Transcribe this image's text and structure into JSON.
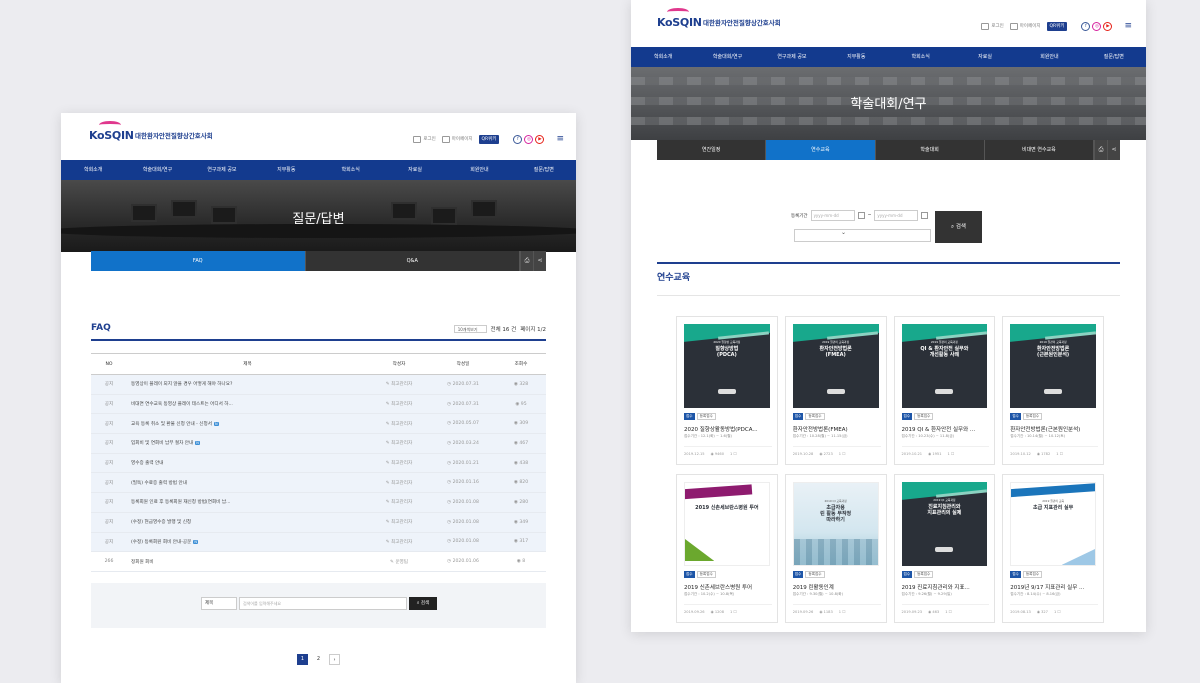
{
  "header": {
    "logo_text": "KoSQIN",
    "org_name": "대한환자안전질향상간호사회",
    "login_label": "로그인",
    "mypage_label": "마이페이지",
    "qr_label": "QR위키",
    "sns": [
      "f",
      "◎",
      "▶"
    ]
  },
  "gnb": [
    "학회소개",
    "학술대회/연구",
    "연구과제 공모",
    "지부활동",
    "학회소식",
    "자료실",
    "회원안내",
    "질문/답변"
  ],
  "left": {
    "hero_title": "질문/답변",
    "subnav": [
      "FAQ",
      "Q&A"
    ],
    "board": {
      "title": "FAQ",
      "per_page": "10개씩보기",
      "total": "전체 16 건",
      "page_info": "페이지 1/2",
      "columns": [
        "NO",
        "제목",
        "작성자",
        "작성일",
        "조회수"
      ],
      "rows": [
        {
          "no": "공지",
          "title": "동영상이 플레이 되지 않을 경우 어떻게 해야 하나요?",
          "writer": "최고관리자",
          "date": "2020.07.31",
          "views": "328",
          "new": false
        },
        {
          "no": "공지",
          "title": "비대면 연수교육 동영상 플레이 테스트는 어디서 하...",
          "writer": "최고관리자",
          "date": "2020.07.31",
          "views": "95",
          "new": false
        },
        {
          "no": "공지",
          "title": "교육 등록 취소 및 환불 신청 안내 - 신청서",
          "writer": "최고관리자",
          "date": "2020.05.07",
          "views": "309",
          "new": true
        },
        {
          "no": "공지",
          "title": "입회비 및 연회비 납부 절차 안내",
          "writer": "최고관리자",
          "date": "2020.03.24",
          "views": "467",
          "new": true
        },
        {
          "no": "공지",
          "title": "영수증 출력 안내",
          "writer": "최고관리자",
          "date": "2020.01.21",
          "views": "438",
          "new": false
        },
        {
          "no": "공지",
          "title": "(필독) 수료증 출력 방법 안내",
          "writer": "최고관리자",
          "date": "2020.01.16",
          "views": "820",
          "new": false
        },
        {
          "no": "공지",
          "title": "등록회원 인료 후 등록회원 재신청 방법(연회비 납...",
          "writer": "최고관리자",
          "date": "2020.01.08",
          "views": "280",
          "new": false
        },
        {
          "no": "공지",
          "title": "(수정) 현금영수증 발행 및 신청",
          "writer": "최고관리자",
          "date": "2020.01.08",
          "views": "349",
          "new": false
        },
        {
          "no": "공지",
          "title": "(수정) 등록회원 회비 안내-공문",
          "writer": "최고관리자",
          "date": "2020.01.08",
          "views": "317",
          "new": true
        },
        {
          "no": "266",
          "title": "정회원 회비",
          "writer": "운영팀",
          "date": "2020.01.06",
          "views": "8",
          "new": false
        }
      ],
      "new_tag": "N"
    },
    "search": {
      "field": "제목",
      "placeholder": "검색어를 입력해주세요",
      "button": "검색"
    },
    "pagination": [
      "1",
      "2",
      "›"
    ]
  },
  "right": {
    "hero_title": "학술대회/연구",
    "subnav": [
      "연간일정",
      "연수교육",
      "학술대회",
      "비대면 연수교육"
    ],
    "period_label": "등록기간",
    "date_placeholder": "yyyy-mm-dd",
    "date_sep": "~",
    "search_button": "검색",
    "section_title": "연수교육",
    "cards": [
      {
        "cover": "dark",
        "cover_sub": "2020 질향상 교육과정",
        "cover_title": "질향상방법\n(PDCA)",
        "badge1": "접수",
        "badge2": "등록접수",
        "title": "2020 질향상활동방법(PDCA...",
        "period": "접수기간 : 12.1(화) ~ 1.6(월)",
        "date": "2019.12.15",
        "views": "9460",
        "likes": "1"
      },
      {
        "cover": "dark",
        "cover_sub": "2019 질관리 교육과정",
        "cover_title": "환자안전방법론\n(FMEA)",
        "badge1": "접수",
        "badge2": "등록접수",
        "title": "환자안전방법론(FMEA)",
        "period": "접수기간 : 10.28(월) ~ 11.15(금)",
        "date": "2019.10.28",
        "views": "2723",
        "likes": "1"
      },
      {
        "cover": "dark",
        "cover_sub": "2019 질관리 교육과정",
        "cover_title": "QI & 환자안전 실무와\n개선활동 사례",
        "badge1": "접수",
        "badge2": "등록접수",
        "title": "2019 QI & 환자안전 실무와 ...",
        "period": "접수기간 : 10.23(수) ~ 11.8(금)",
        "date": "2019.10.21",
        "views": "1951",
        "likes": "1"
      },
      {
        "cover": "dark",
        "cover_sub": "2019 질관리 교육과정",
        "cover_title": "환자안전방법론\n(근본원인분석)",
        "badge1": "접수",
        "badge2": "등록접수",
        "title": "환자안전방법론(근본원인분석)",
        "period": "접수기간 : 10.14(월) ~ 10.12(토)",
        "date": "2019.10.12",
        "views": "1782",
        "likes": "1"
      },
      {
        "cover": "magenta",
        "cover_sub": "",
        "cover_title": "2019 신촌세브란스병원 투어",
        "badge1": "접수",
        "badge2": "등록접수",
        "title": "2019 신촌세브란스병원 투어",
        "period": "접수기간 : 10.2(수) ~ 10.8(목)",
        "date": "2019.09.26",
        "views": "1208",
        "likes": "1"
      },
      {
        "cover": "teal",
        "cover_sub": "2019 QI 교육과정",
        "cover_title": "초급자용\n린 활동 무작정\n따라하기",
        "badge1": "접수",
        "badge2": "등록접수",
        "title": "2019 린활동인계",
        "period": "접수기간 : 9.30(월) ~ 10.8(화)",
        "date": "2019.09.26",
        "views": "1183",
        "likes": "1"
      },
      {
        "cover": "dark",
        "cover_sub": "2019 QI 교육과정",
        "cover_title": "진료지침관리와\n지표관리의 실제",
        "badge1": "접수",
        "badge2": "등록접수",
        "title": "2019 진료지침관리와 지표...",
        "period": "접수기간 : 9.26(월) ~ 9.29(일)",
        "date": "2019.09.23",
        "views": "463",
        "likes": "1"
      },
      {
        "cover": "blue",
        "cover_sub": "2019 질관리 교육",
        "cover_title": "초급 지표관리 실무",
        "badge1": "접수",
        "badge2": "등록접수",
        "title": "2019년 9/17 지표관리 실무 ...",
        "period": "접수기간 : 8.14(수) ~ 8.16(금)",
        "date": "2019.08.13",
        "views": "327",
        "likes": "1"
      }
    ]
  }
}
